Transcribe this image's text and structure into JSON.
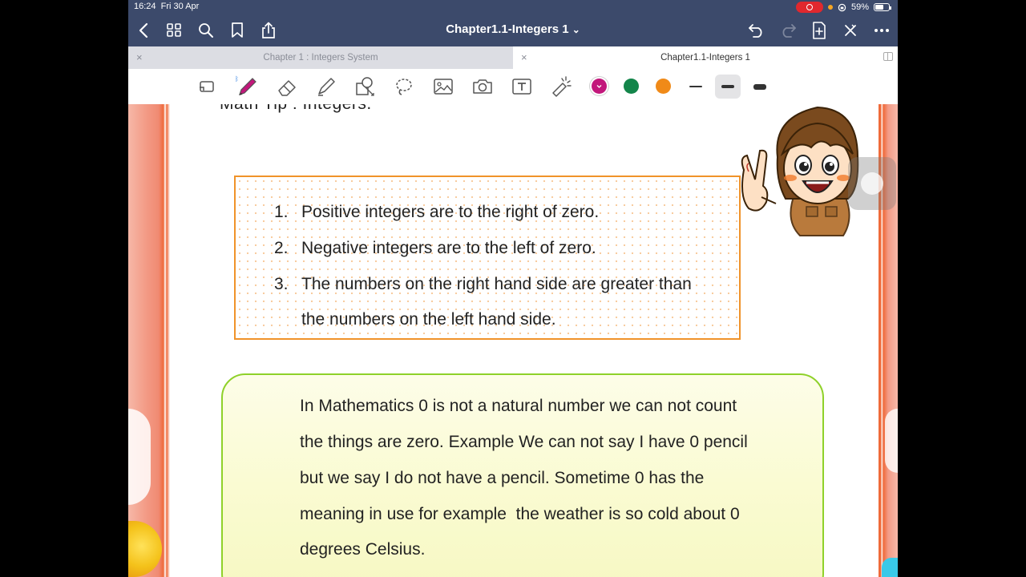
{
  "status_bar": {
    "time": "16:24",
    "date": "Fri 30 Apr",
    "battery": "59%"
  },
  "nav": {
    "title": "Chapter1.1-Integers 1",
    "title_chevron": "⌄",
    "icons": [
      "back-icon",
      "grid-icon",
      "search-icon",
      "bookmark-icon",
      "share-icon",
      "undo-icon",
      "redo-icon",
      "add-page-icon",
      "close-icon",
      "more-icon"
    ]
  },
  "tabs": [
    {
      "label": "Chapter 1 : Integers System",
      "active": false
    },
    {
      "label": "Chapter1.1-Integers 1",
      "active": true
    }
  ],
  "toolbar": {
    "tools": [
      "read-only-icon",
      "pen-icon",
      "eraser-icon",
      "highlighter-icon",
      "shapes-icon",
      "lasso-icon",
      "image-icon",
      "camera-icon",
      "text-icon",
      "laser-pointer-icon"
    ],
    "selected_tool": "pen",
    "colors": [
      "#c2177b",
      "#13854a",
      "#f08a18"
    ],
    "selected_color": "#c2177b",
    "stroke_widths": [
      "thin",
      "medium",
      "thick"
    ],
    "selected_stroke": "medium"
  },
  "document": {
    "heading": "Math Tip :  Integers.",
    "tips": [
      {
        "num": "1.",
        "text": "Positive integers are to the right of zero."
      },
      {
        "num": "2.",
        "text": "Negative integers are to the left of zero."
      },
      {
        "num": "3.",
        "text": "The numbers on the right hand side are greater than"
      }
    ],
    "tip3_cont": "the numbers on the left hand side.",
    "note_lines": [
      "In Mathematics 0 is not a natural number we can not count",
      "the things are zero. Example We can not say I have 0 pencil",
      "but we say I do not have a pencil. Sometime 0 has the",
      "meaning in use for example  the weather is so cold about 0",
      "degrees Celsius."
    ]
  }
}
